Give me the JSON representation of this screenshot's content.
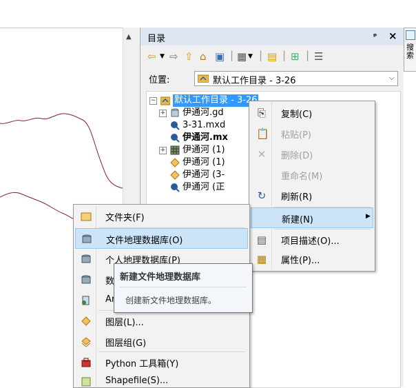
{
  "catalog": {
    "title": "目录",
    "pin_glyph": "₽",
    "close_glyph": "✕",
    "location_label": "位置:",
    "location_value": "默认工作目录 - 3-26",
    "tree": {
      "root": "默认工作目录 - 3-26",
      "items": [
        "伊通河.gd",
        "3-31.mxd",
        "伊通河.mx",
        "伊通河 (1)",
        "伊通河 (1)",
        "伊通河 (3-",
        "伊通河 (正"
      ]
    }
  },
  "side_tab": {
    "label": "搜索"
  },
  "context_menu": {
    "items": [
      {
        "label": "复制(C)",
        "icon": "copy-icon",
        "enabled": true
      },
      {
        "label": "粘贴(P)",
        "icon": "paste-icon",
        "enabled": false
      },
      {
        "label": "删除(D)",
        "icon": "delete-icon",
        "enabled": false
      },
      {
        "label": "重命名(M)",
        "icon": "",
        "enabled": false
      },
      {
        "label": "刷新(R)",
        "icon": "refresh-icon",
        "enabled": true
      },
      {
        "label": "新建(N)",
        "icon": "",
        "enabled": true,
        "highlighted": true,
        "submenu": true
      },
      {
        "label": "项目描述(O)...",
        "icon": "description-icon",
        "enabled": true
      },
      {
        "label": "属性(P)...",
        "icon": "properties-icon",
        "enabled": true
      }
    ]
  },
  "new_submenu": {
    "items": [
      {
        "label": "文件夹(F)",
        "icon": "folder-icon"
      },
      {
        "label": "文件地理数据库(O)",
        "icon": "file-gdb-icon",
        "highlighted": true
      },
      {
        "label": "个人地理数据库(P)",
        "icon": "personal-gdb-icon"
      },
      {
        "label": "数",
        "icon": "db-connection-icon"
      },
      {
        "label": "Ar",
        "icon": "arcgis-server-icon"
      },
      {
        "label": "图层(L)...",
        "icon": "layer-icon"
      },
      {
        "label": "图层组(G)",
        "icon": "group-layer-icon"
      },
      {
        "label": "Python 工具箱(Y)",
        "icon": "python-toolbox-icon"
      },
      {
        "label": "Shapefile(S)...",
        "icon": "shapefile-icon"
      }
    ]
  },
  "tooltip": {
    "title": "新建文件地理数据库",
    "body": "创建新文件地理数据库。"
  },
  "colors": {
    "menu_highlight": "#cce4f7",
    "selection": "#3399ff",
    "map_line": "#8b1a3a"
  }
}
